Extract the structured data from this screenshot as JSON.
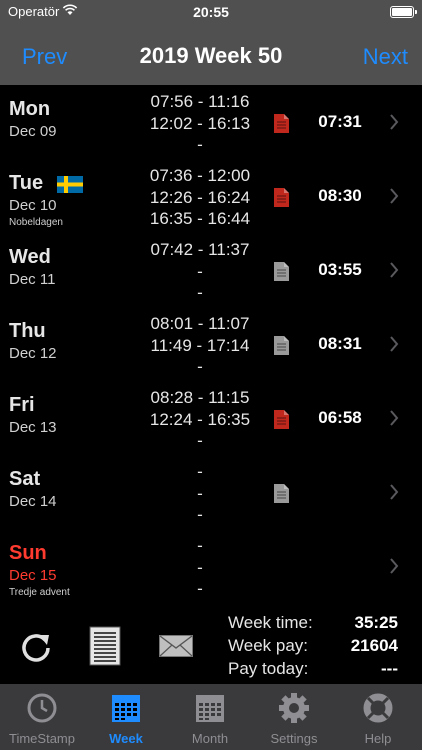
{
  "status_bar": {
    "carrier": "Operatör",
    "time": "20:55"
  },
  "nav": {
    "prev_label": "Prev",
    "title": "2019 Week 50",
    "next_label": "Next"
  },
  "days": [
    {
      "day": "Mon",
      "date": "Dec 09",
      "holiday": "",
      "times": [
        "07:56 - 11:16",
        "12:02 - 16:13",
        "-"
      ],
      "total": "07:31",
      "doc": "red"
    },
    {
      "day": "Tue",
      "date": "Dec 10",
      "holiday": "Nobeldagen",
      "times": [
        "07:36 - 12:00",
        "12:26 - 16:24",
        "16:35 - 16:44"
      ],
      "total": "08:30",
      "doc": "red",
      "flag": "sweden"
    },
    {
      "day": "Wed",
      "date": "Dec 11",
      "holiday": "",
      "times": [
        "07:42 - 11:37",
        "-",
        "-"
      ],
      "total": "03:55",
      "doc": "gray"
    },
    {
      "day": "Thu",
      "date": "Dec 12",
      "holiday": "",
      "times": [
        "08:01 - 11:07",
        "11:49 - 17:14",
        "-"
      ],
      "total": "08:31",
      "doc": "gray"
    },
    {
      "day": "Fri",
      "date": "Dec 13",
      "holiday": "",
      "times": [
        "08:28 - 11:15",
        "12:24 - 16:35",
        "-"
      ],
      "total": "06:58",
      "doc": "red"
    },
    {
      "day": "Sat",
      "date": "Dec 14",
      "holiday": "",
      "times": [
        "-",
        "-",
        "-"
      ],
      "total": "",
      "doc": "gray"
    },
    {
      "day": "Sun",
      "date": "Dec 15",
      "holiday": "Tredje advent",
      "times": [
        "-",
        "-",
        "-"
      ],
      "total": "",
      "doc": "none"
    }
  ],
  "summary": {
    "week_time_label": "Week time:",
    "week_time": "35:25",
    "week_pay_label": "Week pay:",
    "week_pay": "21604",
    "pay_today_label": "Pay today:",
    "pay_today": "---"
  },
  "tabs": [
    {
      "label": "TimeStamp",
      "icon": "clock-icon"
    },
    {
      "label": "Week",
      "icon": "calendar-week-icon",
      "active": true
    },
    {
      "label": "Month",
      "icon": "calendar-month-icon"
    },
    {
      "label": "Settings",
      "icon": "gear-icon"
    },
    {
      "label": "Help",
      "icon": "lifebuoy-icon"
    }
  ],
  "colors": {
    "accent": "#1e8cff",
    "sunday": "#ff3b30",
    "doc_red": "#c0281e",
    "doc_gray": "#9a9a9a"
  }
}
